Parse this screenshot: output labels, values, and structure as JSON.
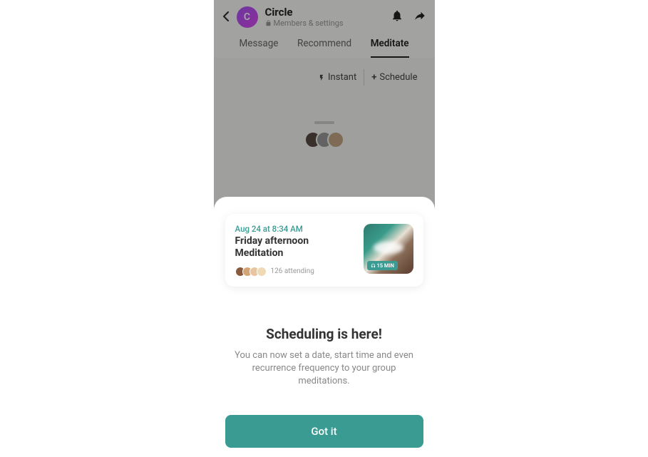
{
  "header": {
    "avatar_letter": "C",
    "title": "Circle",
    "subtitle": "Members & settings"
  },
  "tabs": {
    "message": "Message",
    "recommend": "Recommend",
    "meditate": "Meditate"
  },
  "actions": {
    "instant": "Instant",
    "schedule": "Schedule"
  },
  "card": {
    "date": "Aug 24 at 8:34 AM",
    "title": "Friday afternoon Meditation",
    "attendees": "126 attending",
    "duration": "15 MIN"
  },
  "sheet": {
    "title": "Scheduling is here!",
    "description": "You can now set a date, start time and even recurrence frequency to your group meditations.",
    "button": "Got it"
  }
}
